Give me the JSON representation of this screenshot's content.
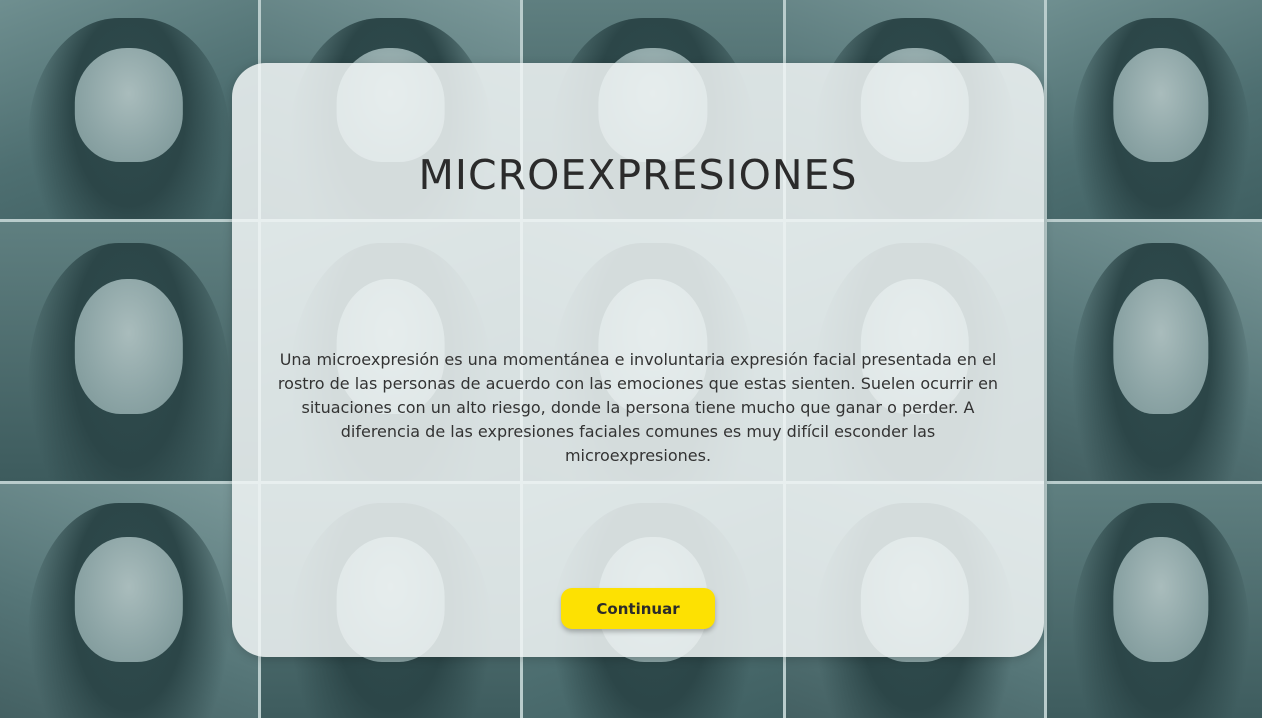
{
  "card": {
    "title": "MICROEXPRESIONES",
    "description": "Una microexpresión es una momentánea e involuntaria expresión facial presentada en el rostro de las personas de acuerdo con las emociones que estas sienten. Suelen ocurrir en situaciones con un alto riesgo, donde la persona tiene mucho que ganar o perder. A diferencia de las expresiones faciales comunes es muy difícil esconder las microexpresiones.",
    "continue_label": "Continuar"
  },
  "background": {
    "photo_count": 15
  },
  "colors": {
    "button": "#fde102",
    "card_tint": "#f0f4f5",
    "photo_tint": "#5b7b7d"
  }
}
